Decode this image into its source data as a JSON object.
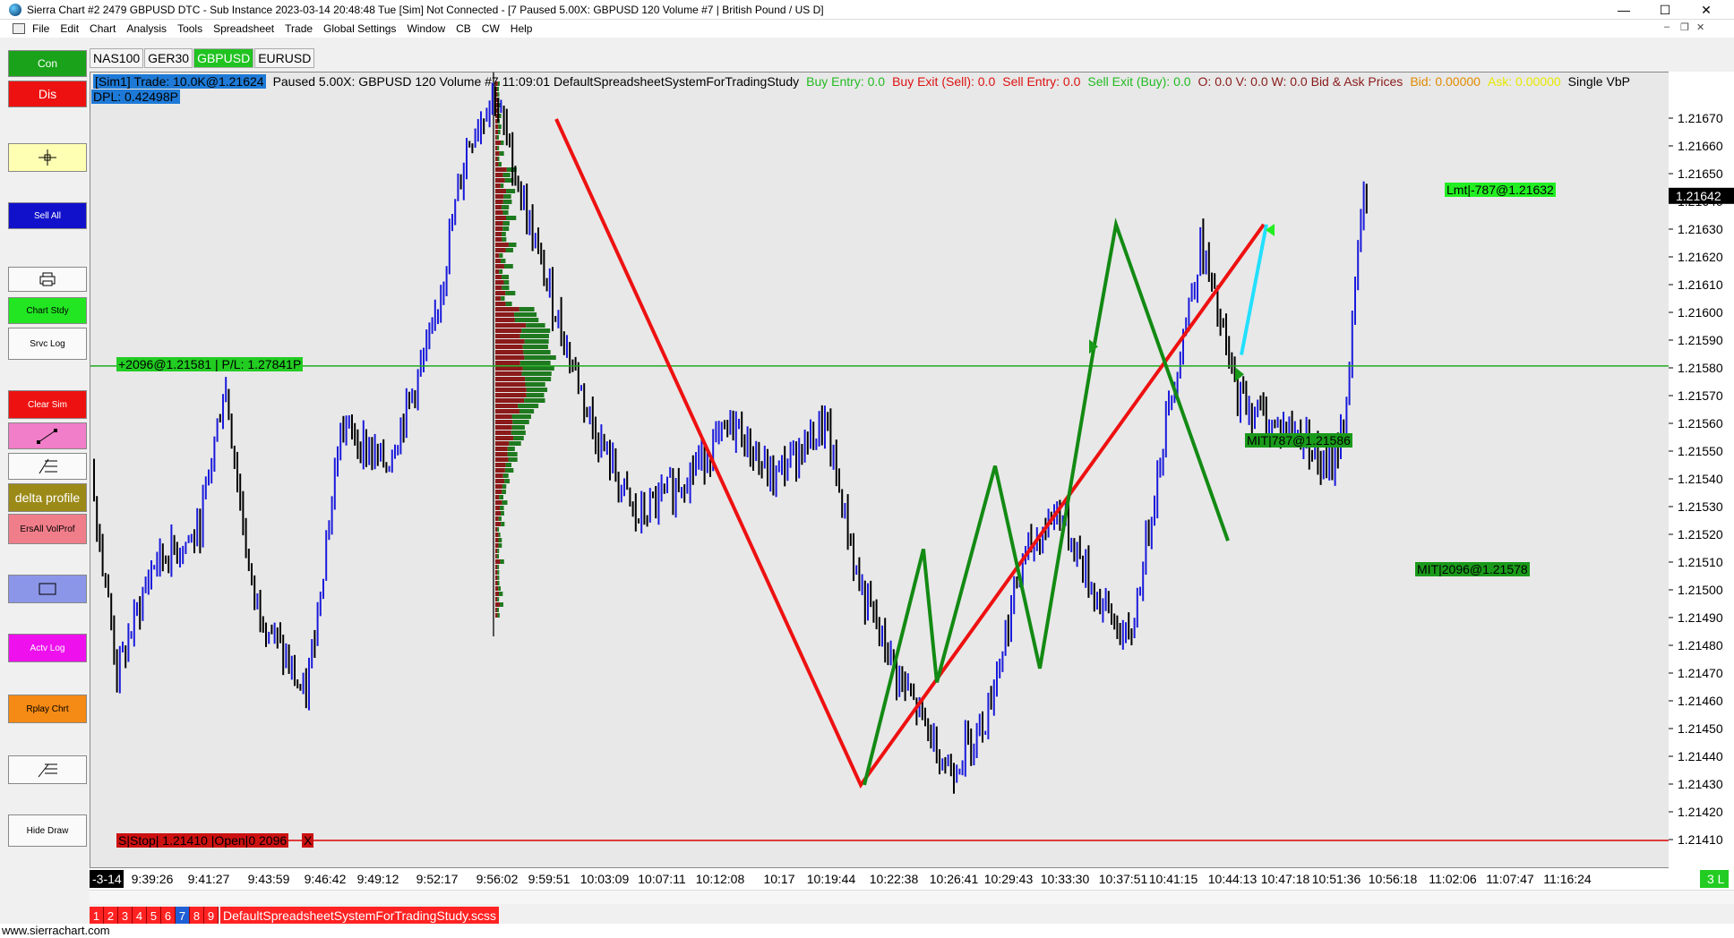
{
  "window": {
    "title": "Sierra Chart #2 2479 GBPUSD  DTC - Sub Instance 2023-03-14  20:48:48 Tue [Sim]  Not Connected - [7 Paused 5.00X: GBPUSD  120 Volume  #7 | British Pound / US D]",
    "minimize": "—",
    "maximize": "☐",
    "close": "✕"
  },
  "menu": {
    "items": [
      "File",
      "Edit",
      "Chart",
      "Analysis",
      "Tools",
      "Spreadsheet",
      "Trade",
      "Global Settings",
      "Window",
      "CB",
      "CW",
      "Help"
    ],
    "mdi_min": "–",
    "mdi_restore": "❐",
    "mdi_close": "✕"
  },
  "toolbar": {
    "con": "Con",
    "dis": "Dis",
    "sell_all": "Sell All",
    "chart_study": "Chart Stdy",
    "service_log": "Srvc Log",
    "clear_sim": "Clear Sim",
    "delta_profile": "delta profile",
    "erase_all_volprof": "ErsAll VolProf",
    "activity_log": "Actv Log",
    "replay_chart": "Rplay Chrt",
    "hide_draw": "Hide Draw"
  },
  "symbol_tabs": [
    "NAS100",
    "GER30",
    "GBPUSD",
    "EURUSD"
  ],
  "active_symbol": "GBPUSD",
  "status": {
    "sim_trade": "[Sim1]  Trade: 10.0K@1.21624",
    "paused": "Paused 5.00X: GBPUSD  120 Volume  #7 11:09:01 DefaultSpreadsheetSystemForTradingStudy",
    "buy_entry": "Buy Entry: 0.0",
    "buy_exit": "Buy Exit (Sell): 0.0",
    "sell_entry": "Sell Entry: 0.0",
    "sell_exit": "Sell Exit (Buy): 0.0",
    "ohlc": "O: 0.0  V: 0.0  W: 0.0  Bid & Ask Prices",
    "bid": "Bid: 0.00000",
    "ask": "Ask: 0.00000",
    "single": "Single VbP",
    "dpl": "DPL: 0.42498P"
  },
  "orders": {
    "position": "+2096@1.21581 | P/L: 1.27841P",
    "limit": "Lmt|-787@1.21632",
    "mit_mid": "MIT|787@1.21586",
    "mit_right": "MIT|2096@1.21578",
    "stop": "S|Stop| 1.21410 |Open|0  2096",
    "stop_close": "X",
    "last_price": "1.21642"
  },
  "colors": {
    "up_bar": "#1a1adc",
    "down_bar": "#000000",
    "red_line": "#ee1111",
    "green_zz": "#138a13",
    "cyan": "#22e0ff",
    "pos_line": "#22aa22",
    "stop_line": "#dd0000"
  },
  "y_axis": {
    "ticks": [
      "1.21670",
      "1.21660",
      "1.21650",
      "1.21640",
      "1.21630",
      "1.21620",
      "1.21610",
      "1.21600",
      "1.21590",
      "1.21580",
      "1.21570",
      "1.21560",
      "1.21550",
      "1.21540",
      "1.21530",
      "1.21520",
      "1.21510",
      "1.21500",
      "1.21490",
      "1.21480",
      "1.21470",
      "1.21460",
      "1.21450",
      "1.21440",
      "1.21430",
      "1.21420",
      "1.21410"
    ]
  },
  "x_axis": {
    "first": "-3-14",
    "ticks": [
      "9:39:26",
      "9:41:27",
      "9:43:59",
      "9:46:42",
      "9:49:12",
      "9:52:17",
      "9:56:02",
      "9:59:51",
      "10:03:09",
      "10:07:11",
      "10:12:08",
      "10:17",
      "10:19:44",
      "10:22:38",
      "10:26:41",
      "10:29:43",
      "10:33:30",
      "10:37:51",
      "10:41:15",
      "10:44:13",
      "10:47:18",
      "10:51:36",
      "10:56:18",
      "11:02:06",
      "11:07:47",
      "11:16:24"
    ],
    "corner": "3 L"
  },
  "bottom": {
    "chart_tabs": [
      "1",
      "2",
      "3",
      "4",
      "5",
      "6",
      "7",
      "8",
      "9"
    ],
    "active_tab": "7",
    "study_file": "DefaultSpreadsheetSystemForTradingStudy.scss"
  },
  "footer": "www.sierrachart.com"
}
